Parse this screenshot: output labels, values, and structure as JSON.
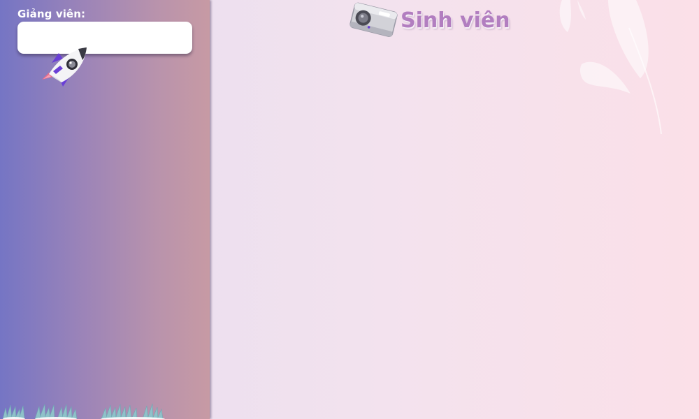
{
  "sidebar": {
    "lecturer_label": "Giảng viên:",
    "lecturer_input_value": "",
    "lecturer_input_placeholder": ""
  },
  "header": {
    "title": "Sinh viên",
    "icon": "projector-icon"
  },
  "decorations": {
    "rocket": "rocket-icon",
    "grass": "grass-decoration",
    "leaves": "leaves-decoration"
  },
  "colors": {
    "sidebar_gradient_start": "#7575c4",
    "sidebar_gradient_end": "#c79aa4",
    "title": "#b27ec0",
    "background_start": "#e6def0",
    "background_end": "#fbe0e8"
  }
}
